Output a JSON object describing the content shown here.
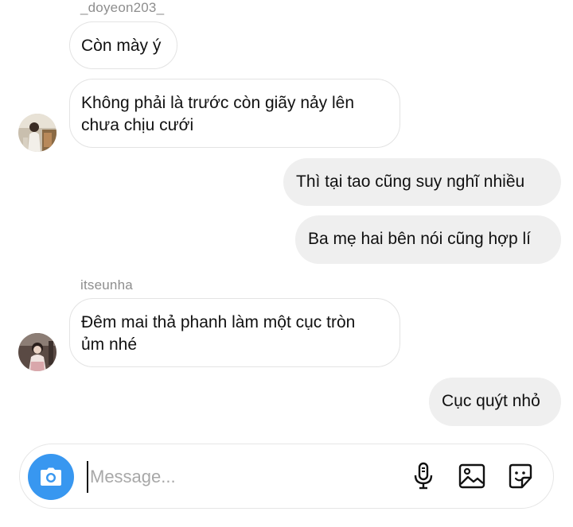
{
  "thread": {
    "sender_top": "_doyeon203_",
    "sender_mid": "itseunha"
  },
  "messages": [
    {
      "from": "in",
      "text": "Còn mày ý"
    },
    {
      "from": "in",
      "line1": "Không phải là trước còn giãy nảy lên",
      "line2": "chưa chịu cưới"
    },
    {
      "from": "out",
      "text": "Thì tại tao cũng suy nghĩ nhiều"
    },
    {
      "from": "out",
      "text": "Ba mẹ hai bên nói cũng hợp lí"
    },
    {
      "from": "in",
      "line1": "Đêm mai thả phanh làm một cục tròn",
      "line2": "ủm nhé"
    },
    {
      "from": "out",
      "text": "Cục quýt nhỏ"
    }
  ],
  "composer": {
    "placeholder": "Message...",
    "icons": [
      "camera-icon",
      "microphone-icon",
      "gallery-icon",
      "sticker-icon"
    ]
  },
  "colors": {
    "accent": "#3897f0",
    "outgoing_bubble": "#efefef",
    "incoming_border": "#e3e3e3",
    "meta_text": "#8e8e8e"
  }
}
